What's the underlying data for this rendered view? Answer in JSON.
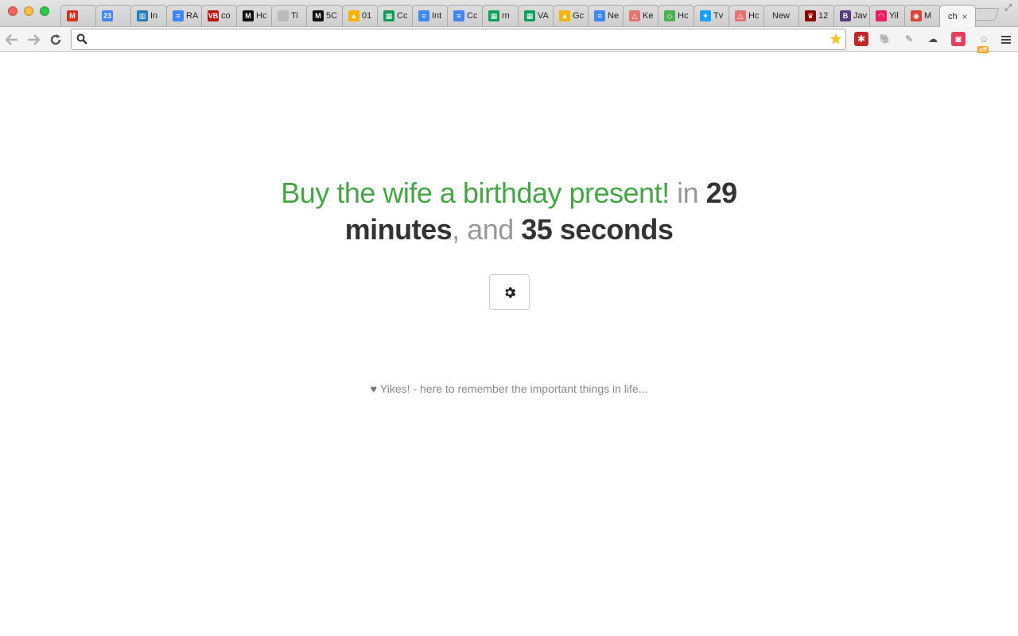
{
  "browser": {
    "tabs": [
      {
        "label": "",
        "icon": "gmail-icon",
        "color": "#d93025",
        "glyph": "M"
      },
      {
        "label": "",
        "icon": "calendar-icon",
        "color": "#4285f4",
        "glyph": "23"
      },
      {
        "label": "In",
        "icon": "trello-icon",
        "color": "#2b7bb9",
        "glyph": "▥"
      },
      {
        "label": "RA",
        "icon": "docs-icon",
        "color": "#4285f4",
        "glyph": "≡"
      },
      {
        "label": "co",
        "icon": "vb-icon",
        "color": "#b11",
        "glyph": "VB"
      },
      {
        "label": "Hc",
        "icon": "medium-icon",
        "color": "#111",
        "glyph": "M"
      },
      {
        "label": "Ti",
        "icon": "page-icon",
        "color": "#bbb",
        "glyph": ""
      },
      {
        "label": "5C",
        "icon": "medium-icon",
        "color": "#111",
        "glyph": "M"
      },
      {
        "label": "01",
        "icon": "drive-icon",
        "color": "#f4b400",
        "glyph": "▲"
      },
      {
        "label": "Cc",
        "icon": "sheets-icon",
        "color": "#0f9d58",
        "glyph": "▦"
      },
      {
        "label": "Int",
        "icon": "docs-icon",
        "color": "#4285f4",
        "glyph": "≡"
      },
      {
        "label": "Cc",
        "icon": "docs-icon",
        "color": "#4285f4",
        "glyph": "≡"
      },
      {
        "label": "rn",
        "icon": "sheets-icon",
        "color": "#0f9d58",
        "glyph": "▦"
      },
      {
        "label": "VA",
        "icon": "sheets-icon",
        "color": "#0f9d58",
        "glyph": "▦"
      },
      {
        "label": "Gc",
        "icon": "drive-icon",
        "color": "#f4b400",
        "glyph": "▲"
      },
      {
        "label": "Ne",
        "icon": "docs-icon",
        "color": "#4285f4",
        "glyph": "≡"
      },
      {
        "label": "Ke",
        "icon": "triangle-icon",
        "color": "#e57373",
        "glyph": "△"
      },
      {
        "label": "Hc",
        "icon": "diamond-icon",
        "color": "#4caf50",
        "glyph": "◇"
      },
      {
        "label": "Tv",
        "icon": "twitter-icon",
        "color": "#1da1f2",
        "glyph": "✦"
      },
      {
        "label": "Hc",
        "icon": "triangle-icon",
        "color": "#e57373",
        "glyph": "△"
      },
      {
        "label": "New",
        "icon": "",
        "color": "",
        "glyph": ""
      },
      {
        "label": "12",
        "icon": "hat-icon",
        "color": "#8b0000",
        "glyph": "♛"
      },
      {
        "label": "Jav",
        "icon": "bootstrap-icon",
        "color": "#563d7c",
        "glyph": "B"
      },
      {
        "label": "Yil",
        "icon": "rainbow-icon",
        "color": "#e91e63",
        "glyph": "◠"
      },
      {
        "label": "M",
        "icon": "chrome-icon",
        "color": "#db4437",
        "glyph": "◉"
      },
      {
        "label": "ch",
        "icon": "",
        "color": "",
        "glyph": "",
        "active": true
      }
    ],
    "omnibox": {
      "value": "",
      "placeholder": ""
    },
    "extensions": [
      {
        "icon": "lastpass-icon",
        "color": "#c0272d",
        "glyph": "✱"
      },
      {
        "icon": "evernote-icon",
        "color": "#555",
        "glyph": "🐘"
      },
      {
        "icon": "pencil-icon",
        "color": "#777",
        "glyph": "✎"
      },
      {
        "icon": "cloud-icon",
        "color": "#444",
        "glyph": "☁"
      },
      {
        "icon": "pocket-icon",
        "color": "#e4405f",
        "glyph": "◙"
      },
      {
        "icon": "ghostery-icon",
        "color": "#999",
        "glyph": "☺"
      }
    ],
    "extension_badge": "off"
  },
  "page": {
    "task": "Buy the wife a birthday present!",
    "word_in": "in",
    "minutes_value": "29",
    "minutes_unit": "minutes",
    "separator": ",",
    "word_and": "and",
    "seconds_value": "35",
    "seconds_unit": "seconds",
    "footer_text": "Yikes! - here to remember the important things in life..."
  },
  "colors": {
    "task": "#47a447",
    "connector": "#999999",
    "emphasis": "#333333"
  }
}
